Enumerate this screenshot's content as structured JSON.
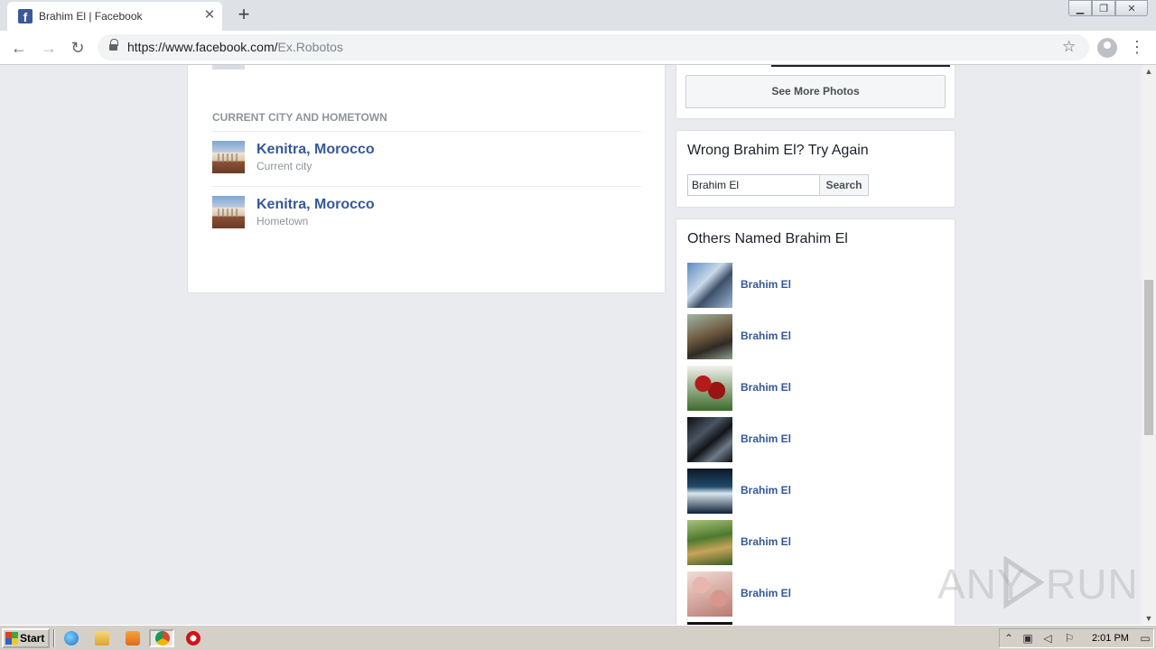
{
  "browser": {
    "tab_title": "Brahim El | Facebook",
    "tab_favicon": "f",
    "url_host": "https://www.facebook.com/",
    "url_path": "Ex.Robotos",
    "new_tab_label": "+"
  },
  "about": {
    "section_heading": "CURRENT CITY AND HOMETOWN",
    "places": [
      {
        "name": "Kenitra, Morocco",
        "type": "Current city"
      },
      {
        "name": "Kenitra, Morocco",
        "type": "Hometown"
      }
    ]
  },
  "photos": {
    "see_more_label": "See More Photos"
  },
  "try_again": {
    "heading": "Wrong Brahim El? Try Again",
    "search_value": "Brahim El",
    "search_button": "Search"
  },
  "others": {
    "heading": "Others Named Brahim El",
    "people": [
      {
        "name": "Brahim El"
      },
      {
        "name": "Brahim El"
      },
      {
        "name": "Brahim El"
      },
      {
        "name": "Brahim El"
      },
      {
        "name": "Brahim El"
      },
      {
        "name": "Brahim El"
      },
      {
        "name": "Brahim El"
      }
    ]
  },
  "watermark": {
    "left_text": "ANY",
    "right_text": "RUN"
  },
  "taskbar": {
    "start_label": "Start",
    "clock": "2:01 PM"
  },
  "colors": {
    "facebook_blue": "#3b5998",
    "link_blue": "#365899",
    "page_bg": "#e9ebee"
  }
}
